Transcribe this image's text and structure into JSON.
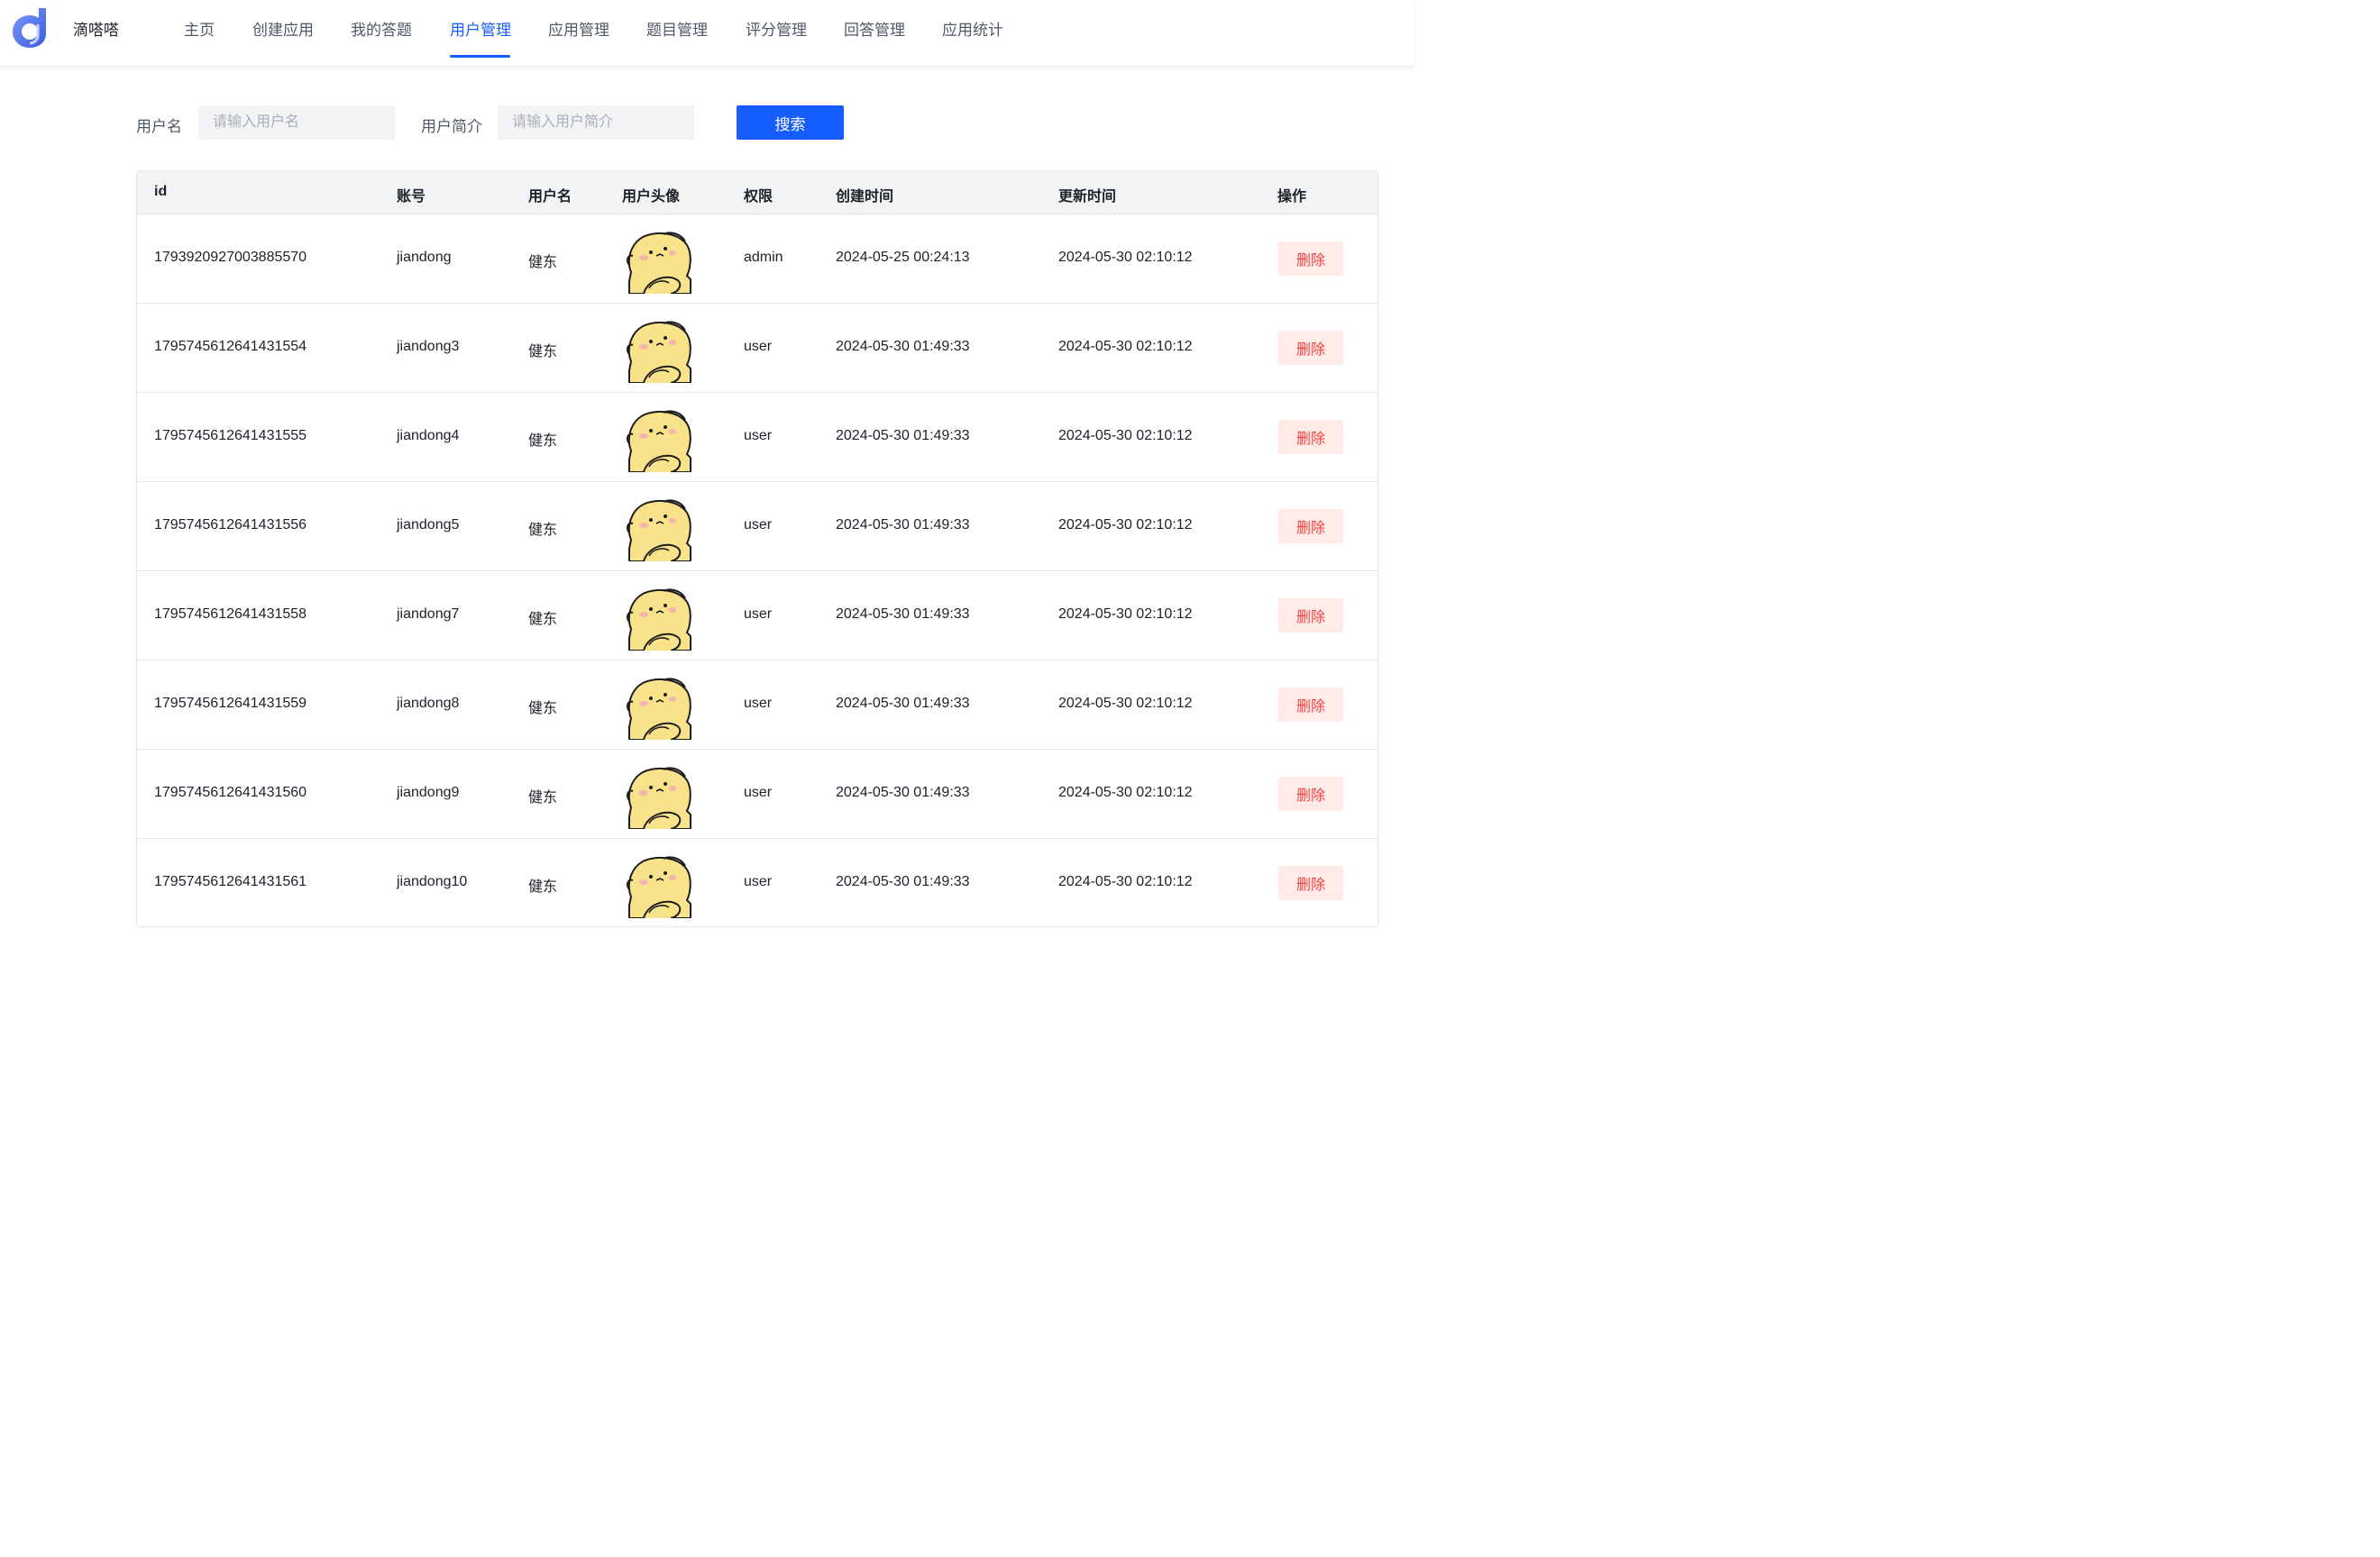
{
  "brand": {
    "name": "滴嗒嗒",
    "accent": "#165dff"
  },
  "nav": {
    "items": [
      {
        "label": "主页"
      },
      {
        "label": "创建应用"
      },
      {
        "label": "我的答题"
      },
      {
        "label": "用户管理",
        "active": true
      },
      {
        "label": "应用管理"
      },
      {
        "label": "题目管理"
      },
      {
        "label": "评分管理"
      },
      {
        "label": "回答管理"
      },
      {
        "label": "应用统计"
      }
    ]
  },
  "search": {
    "username_label": "用户名",
    "username_placeholder": "请输入用户名",
    "profile_label": "用户简介",
    "profile_placeholder": "请输入用户简介",
    "button_label": "搜索"
  },
  "table": {
    "columns": [
      "id",
      "账号",
      "用户名",
      "用户头像",
      "权限",
      "创建时间",
      "更新时间",
      "操作"
    ],
    "rows": [
      {
        "id": "1793920927003885570",
        "account": "jiandong",
        "username": "健东",
        "role": "admin",
        "created": "2024-05-25 00:24:13",
        "updated": "2024-05-30 02:10:12",
        "action": "删除"
      },
      {
        "id": "1795745612641431554",
        "account": "jiandong3",
        "username": "健东",
        "role": "user",
        "created": "2024-05-30 01:49:33",
        "updated": "2024-05-30 02:10:12",
        "action": "删除"
      },
      {
        "id": "1795745612641431555",
        "account": "jiandong4",
        "username": "健东",
        "role": "user",
        "created": "2024-05-30 01:49:33",
        "updated": "2024-05-30 02:10:12",
        "action": "删除"
      },
      {
        "id": "1795745612641431556",
        "account": "jiandong5",
        "username": "健东",
        "role": "user",
        "created": "2024-05-30 01:49:33",
        "updated": "2024-05-30 02:10:12",
        "action": "删除"
      },
      {
        "id": "1795745612641431558",
        "account": "jiandong7",
        "username": "健东",
        "role": "user",
        "created": "2024-05-30 01:49:33",
        "updated": "2024-05-30 02:10:12",
        "action": "删除"
      },
      {
        "id": "1795745612641431559",
        "account": "jiandong8",
        "username": "健东",
        "role": "user",
        "created": "2024-05-30 01:49:33",
        "updated": "2024-05-30 02:10:12",
        "action": "删除"
      },
      {
        "id": "1795745612641431560",
        "account": "jiandong9",
        "username": "健东",
        "role": "user",
        "created": "2024-05-30 01:49:33",
        "updated": "2024-05-30 02:10:12",
        "action": "删除"
      },
      {
        "id": "1795745612641431561",
        "account": "jiandong10",
        "username": "健东",
        "role": "user",
        "created": "2024-05-30 01:49:33",
        "updated": "2024-05-30 02:10:12",
        "action": "删除"
      }
    ]
  },
  "colors": {
    "primary": "#165dff",
    "danger_text": "#f53f3f",
    "danger_bg": "#ffece8",
    "avatar_yellow": "#f8e38b"
  }
}
